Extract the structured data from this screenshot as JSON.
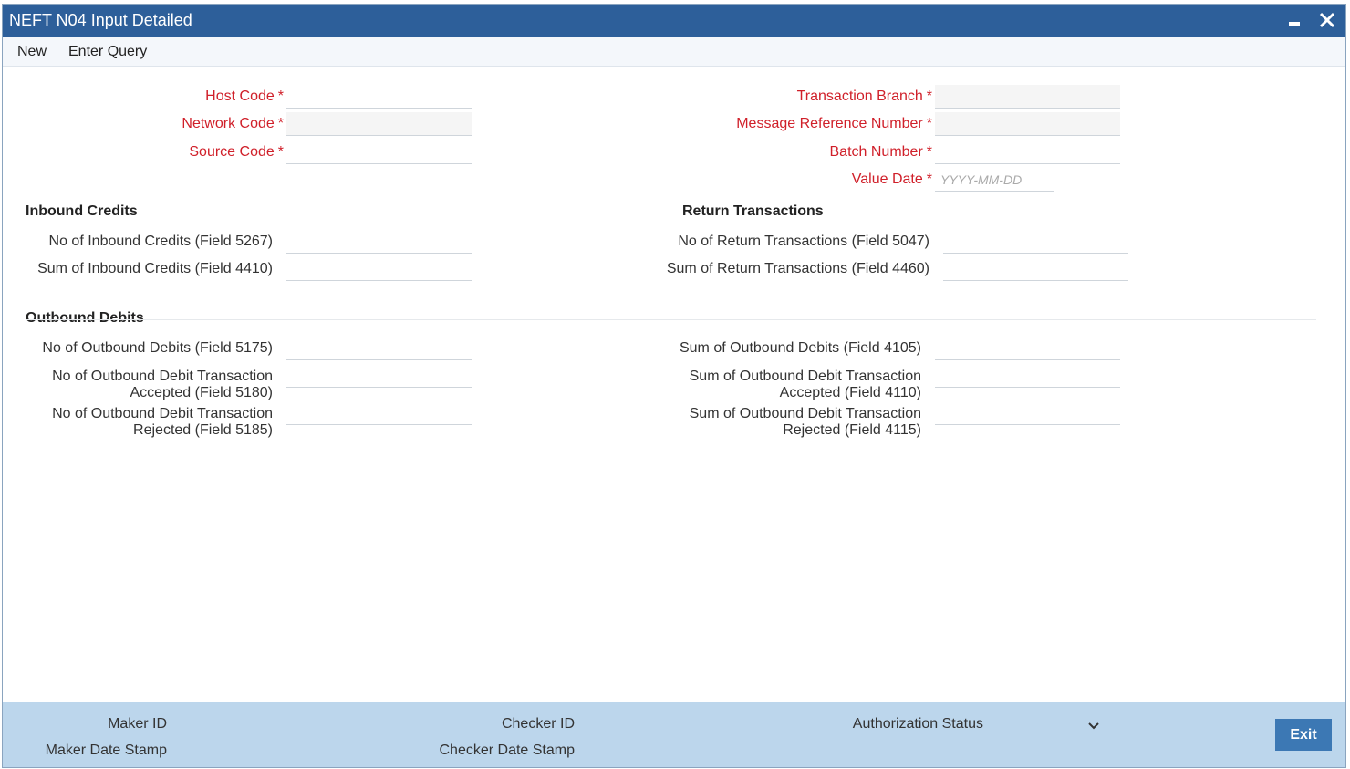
{
  "window": {
    "title": "NEFT N04 Input Detailed"
  },
  "menu": {
    "new": "New",
    "enter_query": "Enter Query"
  },
  "header_fields": {
    "host_code": {
      "label": "Host Code",
      "value": ""
    },
    "network_code": {
      "label": "Network Code",
      "value": ""
    },
    "source_code": {
      "label": "Source Code",
      "value": ""
    },
    "transaction_branch": {
      "label": "Transaction Branch",
      "value": ""
    },
    "message_reference_number": {
      "label": "Message Reference Number",
      "value": ""
    },
    "batch_number": {
      "label": "Batch Number",
      "value": ""
    },
    "value_date": {
      "label": "Value Date",
      "value": "",
      "placeholder": "YYYY-MM-DD"
    },
    "required_mark": "*"
  },
  "inbound_credits": {
    "title": "Inbound Credits",
    "no_label": "No of Inbound Credits (Field 5267)",
    "sum_label": "Sum of Inbound Credits (Field 4410)"
  },
  "return_transactions": {
    "title": "Return Transactions",
    "no_label": "No of Return Transactions (Field 5047)",
    "sum_label": "Sum of Return Transactions (Field 4460)"
  },
  "outbound_debits": {
    "title": "Outbound Debits",
    "no_label": "No of Outbound Debits (Field 5175)",
    "no_accepted_line1": "No of Outbound Debit Transaction",
    "no_accepted_line2": "Accepted (Field 5180)",
    "no_rejected_line1": "No of Outbound Debit Transaction",
    "no_rejected_line2": "Rejected (Field 5185)",
    "sum_label": "Sum of Outbound Debits (Field 4105)",
    "sum_accepted_line1": "Sum of Outbound Debit Transaction",
    "sum_accepted_line2": "Accepted (Field 4110)",
    "sum_rejected_line1": "Sum of Outbound Debit Transaction",
    "sum_rejected_line2": "Rejected (Field 4115)"
  },
  "footer": {
    "maker_id": "Maker ID",
    "maker_date_stamp": "Maker Date Stamp",
    "checker_id": "Checker ID",
    "checker_date_stamp": "Checker Date Stamp",
    "authorization_status": "Authorization Status",
    "exit": "Exit"
  },
  "colors": {
    "titlebar": "#2d5f9a",
    "required": "#d0202a",
    "footer": "#bcd6ec",
    "exit_button": "#3c78b4"
  }
}
